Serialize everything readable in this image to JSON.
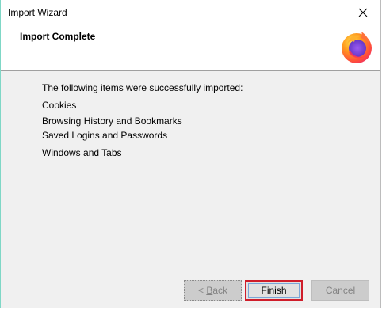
{
  "window": {
    "title": "Import Wizard"
  },
  "header": {
    "title": "Import Complete"
  },
  "content": {
    "intro": "The following items were successfully imported:",
    "items": [
      "Cookies",
      "Browsing History and Bookmarks",
      "Saved Logins and Passwords",
      "Windows and Tabs"
    ]
  },
  "buttons": {
    "back_prefix": "< ",
    "back_key": "B",
    "back_rest": "ack",
    "finish": "Finish",
    "cancel": "Cancel"
  },
  "colors": {
    "highlight": "#cf1d2a",
    "window_bg": "#f0f0f0",
    "header_bg": "#ffffff"
  },
  "icons": {
    "close": "close-icon",
    "logo": "firefox-logo"
  }
}
